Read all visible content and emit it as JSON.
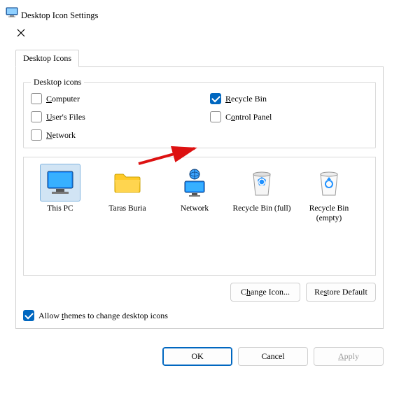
{
  "window": {
    "title": "Desktop Icon Settings"
  },
  "tab": {
    "label": "Desktop Icons"
  },
  "group": {
    "legend": "Desktop icons",
    "items": {
      "computer": {
        "label_pre": "",
        "label_ul": "C",
        "label_post": "omputer",
        "checked": false
      },
      "recycle": {
        "label_pre": "",
        "label_ul": "R",
        "label_post": "ecycle Bin",
        "checked": true
      },
      "userfiles": {
        "label_pre": "",
        "label_ul": "U",
        "label_post": "ser's Files",
        "checked": false
      },
      "controlpanel": {
        "label_pre": "C",
        "label_ul": "o",
        "label_post": "ntrol Panel",
        "checked": false
      },
      "network": {
        "label_pre": "",
        "label_ul": "N",
        "label_post": "etwork",
        "checked": false
      }
    }
  },
  "icons": [
    {
      "key": "thispc",
      "label": "This PC",
      "selected": true
    },
    {
      "key": "userfolder",
      "label": "Taras Buria",
      "selected": false
    },
    {
      "key": "network",
      "label": "Network",
      "selected": false
    },
    {
      "key": "recyclefull",
      "label": "Recycle Bin (full)",
      "selected": false
    },
    {
      "key": "recycleempty",
      "label": "Recycle Bin (empty)",
      "selected": false
    }
  ],
  "buttons": {
    "change_icon": "Change Icon...",
    "restore_default": "Restore Default",
    "ok": "OK",
    "cancel": "Cancel",
    "apply": "Apply"
  },
  "allow_themes": {
    "label_pre": "Allow ",
    "label_ul": "t",
    "label_post": "hemes to change desktop icons",
    "checked": true
  }
}
